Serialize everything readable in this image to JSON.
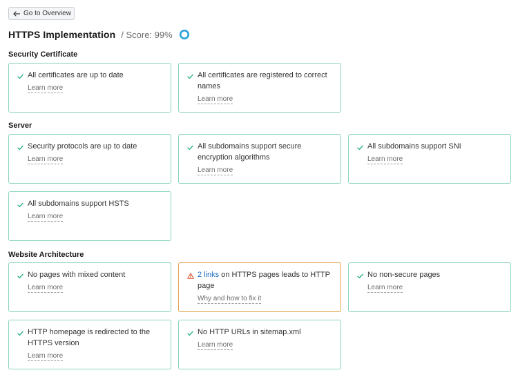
{
  "nav": {
    "back_label": "Go to Overview"
  },
  "header": {
    "title": "HTTPS Implementation",
    "score_text": "/ Score: 99%",
    "score_value": 99
  },
  "colors": {
    "success": "#2fb38f",
    "warning": "#e0623f",
    "link": "#1a6fc4",
    "border_ok": "#89d3bf",
    "border_warn": "#e4a24e",
    "score_ring": "#2aa3dc"
  },
  "sections": {
    "security_certificate": {
      "title": "Security Certificate",
      "checks": [
        {
          "status": "ok",
          "icon": "check-icon",
          "text": "All certificates are up to date",
          "link": "Learn more"
        },
        {
          "status": "ok",
          "icon": "check-icon",
          "text": "All certificates are registered to correct names",
          "link": "Learn more"
        }
      ]
    },
    "server": {
      "title": "Server",
      "checks": [
        {
          "status": "ok",
          "icon": "check-icon",
          "text": "Security protocols are up to date",
          "link": "Learn more"
        },
        {
          "status": "ok",
          "icon": "check-icon",
          "text": "All subdomains support secure encryption algorithms",
          "link": "Learn more"
        },
        {
          "status": "ok",
          "icon": "check-icon",
          "text": "All subdomains support SNI",
          "link": "Learn more"
        },
        {
          "status": "ok",
          "icon": "check-icon",
          "text": "All subdomains support HSTS",
          "link": "Learn more"
        }
      ]
    },
    "website_architecture": {
      "title": "Website Architecture",
      "checks": [
        {
          "status": "ok",
          "icon": "check-icon",
          "text": "No pages with mixed content",
          "link": "Learn more"
        },
        {
          "status": "warning",
          "icon": "warning-icon",
          "highlight": "2 links",
          "text": " on HTTPS pages leads to HTTP page",
          "link": "Why and how to fix it"
        },
        {
          "status": "ok",
          "icon": "check-icon",
          "text": "No non-secure pages",
          "link": "Learn more"
        },
        {
          "status": "ok",
          "icon": "check-icon",
          "text": "HTTP homepage is redirected to the HTTPS version",
          "link": "Learn more"
        },
        {
          "status": "ok",
          "icon": "check-icon",
          "text": "No HTTP URLs in sitemap.xml",
          "link": "Learn more"
        }
      ]
    }
  }
}
